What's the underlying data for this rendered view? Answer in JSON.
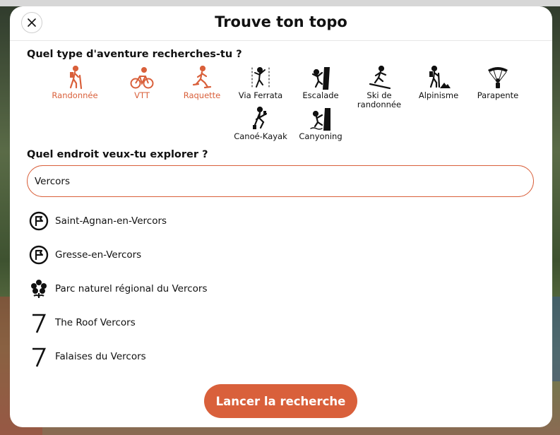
{
  "modal": {
    "title": "Trouve ton topo",
    "activity_question": "Quel type d'aventure recherches-tu ?",
    "location_question": "Quel endroit veux-tu explorer ?",
    "search_value": "Vercors",
    "launch_label": "Lancer la recherche"
  },
  "colors": {
    "accent": "#d9603b",
    "text": "#111111"
  },
  "activities": [
    {
      "label": "Randonnée",
      "icon": "hiker-icon",
      "selected": true
    },
    {
      "label": "VTT",
      "icon": "bike-icon",
      "selected": true
    },
    {
      "label": "Raquette",
      "icon": "snowshoe-icon",
      "selected": true
    },
    {
      "label": "Via Ferrata",
      "icon": "via-ferrata-icon",
      "selected": false
    },
    {
      "label": "Escalade",
      "icon": "climbing-icon",
      "selected": false
    },
    {
      "label": "Ski de randonnée",
      "icon": "ski-touring-icon",
      "selected": false
    },
    {
      "label": "Alpinisme",
      "icon": "mountaineering-icon",
      "selected": false
    },
    {
      "label": "Parapente",
      "icon": "paraglider-icon",
      "selected": false
    },
    {
      "label": "Canoé-Kayak",
      "icon": "kayak-icon",
      "selected": false
    },
    {
      "label": "Canyoning",
      "icon": "canyoning-icon",
      "selected": false
    }
  ],
  "results": [
    {
      "label": "Saint-Agnan-en-Vercors",
      "icon": "village-flag-icon"
    },
    {
      "label": "Gresse-en-Vercors",
      "icon": "village-flag-icon"
    },
    {
      "label": "Parc naturel régional du Vercors",
      "icon": "park-flower-icon"
    },
    {
      "label": "The Roof Vercors",
      "icon": "crag-seven-icon"
    },
    {
      "label": "Falaises du Vercors",
      "icon": "crag-seven-icon"
    }
  ]
}
